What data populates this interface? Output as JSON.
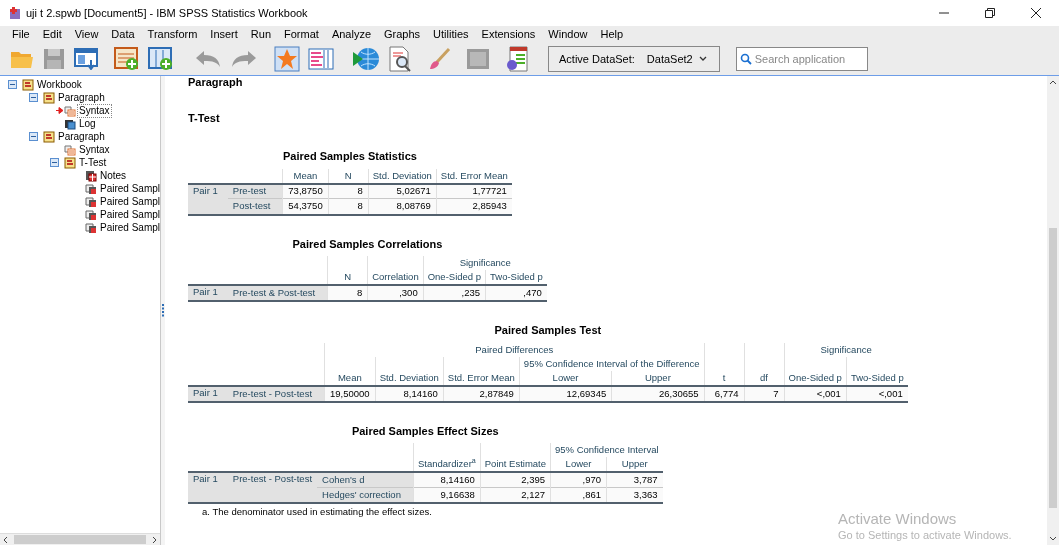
{
  "window": {
    "title": "uji t 2.spwb [Document5] - IBM SPSS Statistics Workbook"
  },
  "menu": [
    "File",
    "Edit",
    "View",
    "Data",
    "Transform",
    "Insert",
    "Run",
    "Format",
    "Analyze",
    "Graphs",
    "Utilities",
    "Extensions",
    "Window",
    "Help"
  ],
  "toolbar": {
    "dataset_label": "Active DataSet:",
    "dataset_value": "DataSet2",
    "search": {
      "placeholder": "Search application"
    }
  },
  "outline": [
    {
      "label": "Workbook",
      "kind": "book",
      "selected": false,
      "expanded": true,
      "children": [
        {
          "label": "Paragraph",
          "kind": "book",
          "selected": false,
          "expanded": true,
          "children": [
            {
              "label": "Syntax",
              "kind": "syntax",
              "selected": true
            },
            {
              "label": "Log",
              "kind": "log",
              "selected": false
            }
          ]
        },
        {
          "label": "Paragraph",
          "kind": "book",
          "selected": false,
          "expanded": true,
          "children": [
            {
              "label": "Syntax",
              "kind": "syntax",
              "selected": false
            },
            {
              "label": "T-Test",
              "kind": "book",
              "selected": false,
              "expanded": true,
              "children": [
                {
                  "label": "Notes",
                  "kind": "notes",
                  "selected": false
                },
                {
                  "label": "Paired Sampl",
                  "kind": "table",
                  "selected": false
                },
                {
                  "label": "Paired Sampl",
                  "kind": "table",
                  "selected": false
                },
                {
                  "label": "Paired Sampl",
                  "kind": "table",
                  "selected": false
                },
                {
                  "label": "Paired Sampl",
                  "kind": "table",
                  "selected": false
                }
              ]
            }
          ]
        }
      ]
    }
  ],
  "document": [
    {
      "kind": "heading",
      "text": "Paragraph"
    },
    {
      "kind": "heading",
      "text": "T-Test"
    },
    {
      "kind": "table",
      "title": "Paired Samples Statistics",
      "header": [
        {
          "label": "Mean"
        },
        {
          "label": "N"
        },
        {
          "label": "Std. Deviation"
        },
        {
          "label": "Std. Error Mean"
        }
      ],
      "pairs": [
        {
          "pair": "Pair 1",
          "rows": [
            {
              "label": "Pre-test",
              "values": [
                "73,8750",
                "8",
                "5,02671",
                "1,77721"
              ]
            },
            {
              "label": "Post-test",
              "values": [
                "54,3750",
                "8",
                "8,08769",
                "2,85943"
              ]
            }
          ]
        }
      ]
    },
    {
      "kind": "table",
      "title": "Paired Samples Correlations",
      "header": [
        {
          "label": "N"
        },
        {
          "label": "Correlation"
        },
        {
          "label": "Significance",
          "children": [
            {
              "label": "One-Sided p"
            },
            {
              "label": "Two-Sided p"
            }
          ]
        }
      ],
      "pairs": [
        {
          "pair": "Pair 1",
          "rows": [
            {
              "label": "Pre-test & Post-test",
              "values": [
                "8",
                ",300",
                ",235",
                ",470"
              ]
            }
          ]
        }
      ]
    },
    {
      "kind": "table",
      "title": "Paired Samples Test",
      "header": [
        {
          "label": "Paired Differences",
          "children": [
            {
              "label": "Mean"
            },
            {
              "label": "Std. Deviation"
            },
            {
              "label": "Std. Error Mean"
            },
            {
              "label": "95% Confidence Interval of the Difference",
              "children": [
                {
                  "label": "Lower"
                },
                {
                  "label": "Upper"
                }
              ]
            }
          ]
        },
        {
          "label": "t"
        },
        {
          "label": "df"
        },
        {
          "label": "Significance",
          "children": [
            {
              "label": "One-Sided p"
            },
            {
              "label": "Two-Sided p"
            }
          ]
        }
      ],
      "pairs": [
        {
          "pair": "Pair 1",
          "rows": [
            {
              "label": "Pre-test - Post-test",
              "values": [
                "19,50000",
                "8,14160",
                "2,87849",
                "12,69345",
                "26,30655",
                "6,774",
                "7",
                "<,001",
                "<,001"
              ]
            }
          ]
        }
      ]
    },
    {
      "kind": "table",
      "title": "Paired Samples Effect Sizes",
      "header": [
        {
          "label": "Standardizer$^{a}$"
        },
        {
          "label": "Point Estimate"
        },
        {
          "label": "95% Confidence Interval",
          "children": [
            {
              "label": "Lower"
            },
            {
              "label": "Upper"
            }
          ]
        }
      ],
      "pairs": [
        {
          "pair": "Pair 1",
          "variable": "Pre-test - Post-test",
          "rows": [
            {
              "label": "Cohen's d",
              "values": [
                "8,14160",
                "2,395",
                ",970",
                "3,787"
              ]
            },
            {
              "label": "Hedges' correction",
              "values": [
                "9,16638",
                "2,127",
                ",861",
                "3,363"
              ]
            }
          ]
        }
      ],
      "footnotes": [
        "a. The denominator used in estimating the effect sizes."
      ]
    }
  ],
  "os_notice": {
    "title": "Activate Windows",
    "subtitle": "Go to Settings to activate Windows."
  }
}
